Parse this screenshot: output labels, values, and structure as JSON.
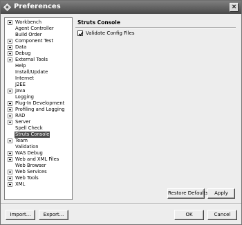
{
  "window": {
    "title": "Preferences",
    "close_label": "×"
  },
  "tree": {
    "items": [
      {
        "label": "Workbench",
        "expandable": true
      },
      {
        "label": "Agent Controller",
        "expandable": false
      },
      {
        "label": "Build Order",
        "expandable": false
      },
      {
        "label": "Component Test",
        "expandable": true
      },
      {
        "label": "Data",
        "expandable": true
      },
      {
        "label": "Debug",
        "expandable": true
      },
      {
        "label": "External Tools",
        "expandable": true
      },
      {
        "label": "Help",
        "expandable": false
      },
      {
        "label": "Install/Update",
        "expandable": false
      },
      {
        "label": "Internet",
        "expandable": false
      },
      {
        "label": "J2EE",
        "expandable": false
      },
      {
        "label": "Java",
        "expandable": true
      },
      {
        "label": "Logging",
        "expandable": false
      },
      {
        "label": "Plug-In Development",
        "expandable": true
      },
      {
        "label": "Profiling and Logging",
        "expandable": true
      },
      {
        "label": "RAD",
        "expandable": true
      },
      {
        "label": "Server",
        "expandable": true
      },
      {
        "label": "Spell Check",
        "expandable": false
      },
      {
        "label": "Struts Console",
        "expandable": false,
        "selected": true
      },
      {
        "label": "Team",
        "expandable": true
      },
      {
        "label": "Validation",
        "expandable": false
      },
      {
        "label": "WAS Debug",
        "expandable": true
      },
      {
        "label": "Web and XML Files",
        "expandable": true
      },
      {
        "label": "Web Browser",
        "expandable": false
      },
      {
        "label": "Web Services",
        "expandable": true
      },
      {
        "label": "Web Tools",
        "expandable": true
      },
      {
        "label": "XML",
        "expandable": true
      }
    ]
  },
  "page": {
    "title": "Struts Console",
    "validate_label": "Validate Config Files",
    "validate_checked": true
  },
  "buttons": {
    "restore_defaults": "Restore Defaults",
    "apply": "Apply",
    "import": "Import...",
    "export": "Export...",
    "ok": "OK",
    "cancel": "Cancel"
  }
}
